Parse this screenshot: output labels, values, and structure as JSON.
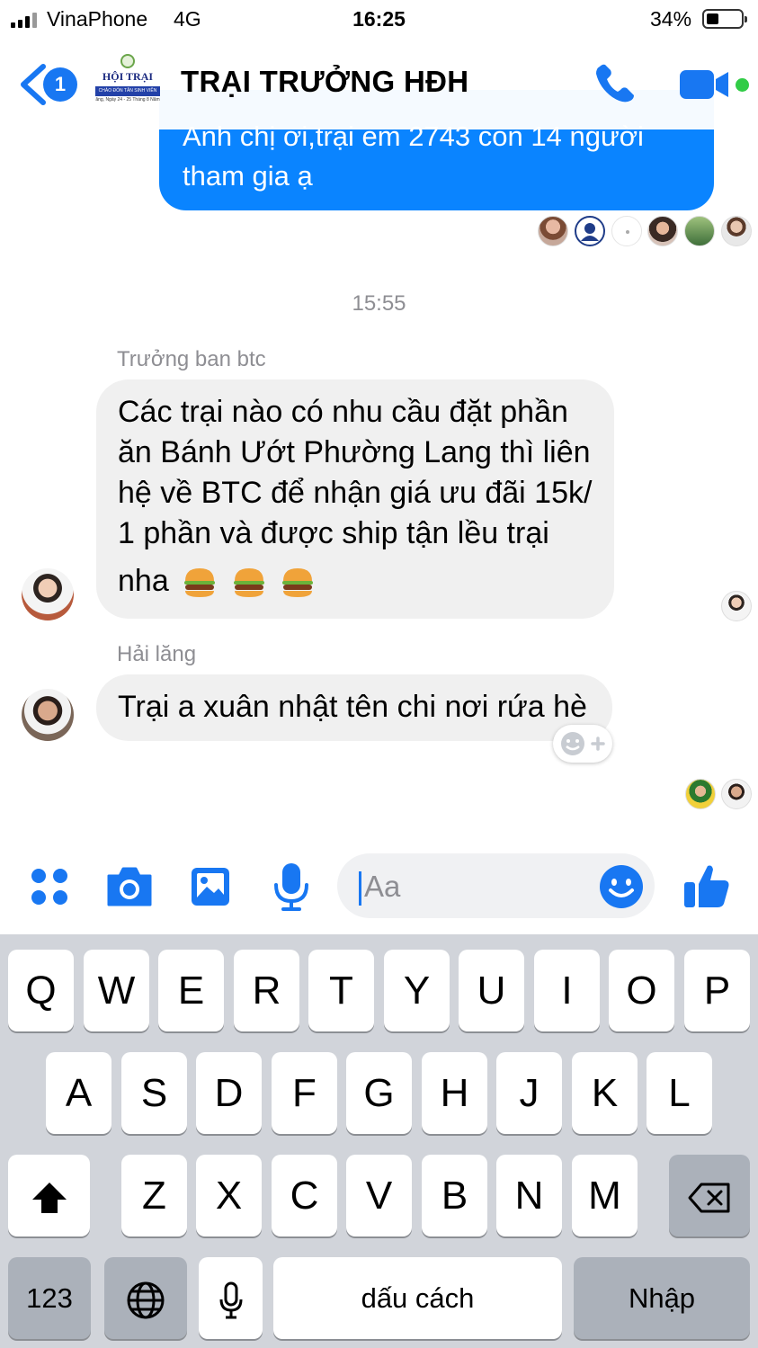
{
  "status_bar": {
    "carrier": "VinaPhone",
    "network": "4G",
    "time": "16:25",
    "battery_percent": "34%",
    "battery_level": 0.34
  },
  "header": {
    "back_badge_count": "1",
    "group_name": "TRẠI TRƯỞNG HĐH",
    "logo_text": "HỘI TRẠI",
    "logo_strip_text": "CHÀO ĐÓN TÂN SINH VIÊN",
    "logo_sub_text": "ẵng, Ngày 24 - 25 Tháng 8 Năm",
    "online_color": "#31cc46",
    "accent_color": "#1877f2"
  },
  "chat": {
    "outgoing_message": {
      "line1": "Anh chị ơi,trại em 2743 con 14 người",
      "line2": "tham gia ạ",
      "color": "#0a84ff"
    },
    "timestamp": "15:55",
    "message_1": {
      "sender": "Trưởng ban btc",
      "lines": [
        "Các trại nào có nhu cầu đặt phần",
        "ăn Bánh Ướt Phường Lang thì liên",
        "hệ về BTC để nhận giá ưu đãi 15k/",
        "1 phần và được ship tận lều trại"
      ],
      "last_line": "nha",
      "emoji": [
        "hamburger-emoji",
        "hamburger-emoji",
        "hamburger-emoji"
      ]
    },
    "message_2": {
      "sender": "Hải lăng",
      "text": "Trại a xuân nhật tên chi nơi rứa hè"
    }
  },
  "composer": {
    "placeholder": "Aa",
    "icons": [
      "apps-icon",
      "camera-icon",
      "gallery-icon",
      "microphone-icon",
      "emoji-icon",
      "thumbs-up-icon"
    ]
  },
  "keyboard": {
    "row1": [
      "Q",
      "W",
      "E",
      "R",
      "T",
      "Y",
      "U",
      "I",
      "O",
      "P"
    ],
    "row2": [
      "A",
      "S",
      "D",
      "F",
      "G",
      "H",
      "J",
      "K",
      "L"
    ],
    "row3": [
      "Z",
      "X",
      "C",
      "V",
      "B",
      "N",
      "M"
    ],
    "numbers_key": "123",
    "space_key": "dấu cách",
    "return_key": "Nhập"
  }
}
